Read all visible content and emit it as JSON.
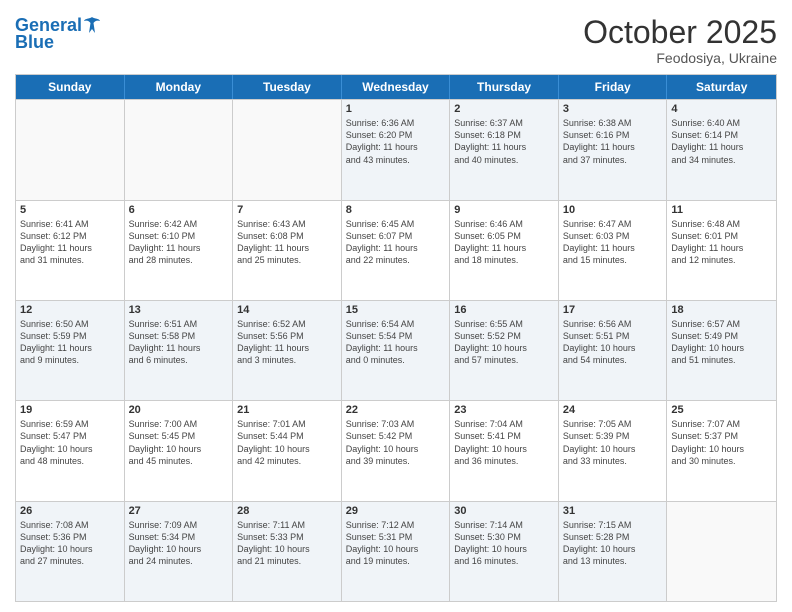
{
  "header": {
    "logo_line1": "General",
    "logo_line2": "Blue",
    "title": "October 2025",
    "subtitle": "Feodosiya, Ukraine"
  },
  "weekdays": [
    "Sunday",
    "Monday",
    "Tuesday",
    "Wednesday",
    "Thursday",
    "Friday",
    "Saturday"
  ],
  "weeks": [
    [
      {
        "day": "",
        "info": ""
      },
      {
        "day": "",
        "info": ""
      },
      {
        "day": "",
        "info": ""
      },
      {
        "day": "1",
        "info": "Sunrise: 6:36 AM\nSunset: 6:20 PM\nDaylight: 11 hours\nand 43 minutes."
      },
      {
        "day": "2",
        "info": "Sunrise: 6:37 AM\nSunset: 6:18 PM\nDaylight: 11 hours\nand 40 minutes."
      },
      {
        "day": "3",
        "info": "Sunrise: 6:38 AM\nSunset: 6:16 PM\nDaylight: 11 hours\nand 37 minutes."
      },
      {
        "day": "4",
        "info": "Sunrise: 6:40 AM\nSunset: 6:14 PM\nDaylight: 11 hours\nand 34 minutes."
      }
    ],
    [
      {
        "day": "5",
        "info": "Sunrise: 6:41 AM\nSunset: 6:12 PM\nDaylight: 11 hours\nand 31 minutes."
      },
      {
        "day": "6",
        "info": "Sunrise: 6:42 AM\nSunset: 6:10 PM\nDaylight: 11 hours\nand 28 minutes."
      },
      {
        "day": "7",
        "info": "Sunrise: 6:43 AM\nSunset: 6:08 PM\nDaylight: 11 hours\nand 25 minutes."
      },
      {
        "day": "8",
        "info": "Sunrise: 6:45 AM\nSunset: 6:07 PM\nDaylight: 11 hours\nand 22 minutes."
      },
      {
        "day": "9",
        "info": "Sunrise: 6:46 AM\nSunset: 6:05 PM\nDaylight: 11 hours\nand 18 minutes."
      },
      {
        "day": "10",
        "info": "Sunrise: 6:47 AM\nSunset: 6:03 PM\nDaylight: 11 hours\nand 15 minutes."
      },
      {
        "day": "11",
        "info": "Sunrise: 6:48 AM\nSunset: 6:01 PM\nDaylight: 11 hours\nand 12 minutes."
      }
    ],
    [
      {
        "day": "12",
        "info": "Sunrise: 6:50 AM\nSunset: 5:59 PM\nDaylight: 11 hours\nand 9 minutes."
      },
      {
        "day": "13",
        "info": "Sunrise: 6:51 AM\nSunset: 5:58 PM\nDaylight: 11 hours\nand 6 minutes."
      },
      {
        "day": "14",
        "info": "Sunrise: 6:52 AM\nSunset: 5:56 PM\nDaylight: 11 hours\nand 3 minutes."
      },
      {
        "day": "15",
        "info": "Sunrise: 6:54 AM\nSunset: 5:54 PM\nDaylight: 11 hours\nand 0 minutes."
      },
      {
        "day": "16",
        "info": "Sunrise: 6:55 AM\nSunset: 5:52 PM\nDaylight: 10 hours\nand 57 minutes."
      },
      {
        "day": "17",
        "info": "Sunrise: 6:56 AM\nSunset: 5:51 PM\nDaylight: 10 hours\nand 54 minutes."
      },
      {
        "day": "18",
        "info": "Sunrise: 6:57 AM\nSunset: 5:49 PM\nDaylight: 10 hours\nand 51 minutes."
      }
    ],
    [
      {
        "day": "19",
        "info": "Sunrise: 6:59 AM\nSunset: 5:47 PM\nDaylight: 10 hours\nand 48 minutes."
      },
      {
        "day": "20",
        "info": "Sunrise: 7:00 AM\nSunset: 5:45 PM\nDaylight: 10 hours\nand 45 minutes."
      },
      {
        "day": "21",
        "info": "Sunrise: 7:01 AM\nSunset: 5:44 PM\nDaylight: 10 hours\nand 42 minutes."
      },
      {
        "day": "22",
        "info": "Sunrise: 7:03 AM\nSunset: 5:42 PM\nDaylight: 10 hours\nand 39 minutes."
      },
      {
        "day": "23",
        "info": "Sunrise: 7:04 AM\nSunset: 5:41 PM\nDaylight: 10 hours\nand 36 minutes."
      },
      {
        "day": "24",
        "info": "Sunrise: 7:05 AM\nSunset: 5:39 PM\nDaylight: 10 hours\nand 33 minutes."
      },
      {
        "day": "25",
        "info": "Sunrise: 7:07 AM\nSunset: 5:37 PM\nDaylight: 10 hours\nand 30 minutes."
      }
    ],
    [
      {
        "day": "26",
        "info": "Sunrise: 7:08 AM\nSunset: 5:36 PM\nDaylight: 10 hours\nand 27 minutes."
      },
      {
        "day": "27",
        "info": "Sunrise: 7:09 AM\nSunset: 5:34 PM\nDaylight: 10 hours\nand 24 minutes."
      },
      {
        "day": "28",
        "info": "Sunrise: 7:11 AM\nSunset: 5:33 PM\nDaylight: 10 hours\nand 21 minutes."
      },
      {
        "day": "29",
        "info": "Sunrise: 7:12 AM\nSunset: 5:31 PM\nDaylight: 10 hours\nand 19 minutes."
      },
      {
        "day": "30",
        "info": "Sunrise: 7:14 AM\nSunset: 5:30 PM\nDaylight: 10 hours\nand 16 minutes."
      },
      {
        "day": "31",
        "info": "Sunrise: 7:15 AM\nSunset: 5:28 PM\nDaylight: 10 hours\nand 13 minutes."
      },
      {
        "day": "",
        "info": ""
      }
    ]
  ],
  "alt_weeks": [
    0,
    2,
    4
  ]
}
